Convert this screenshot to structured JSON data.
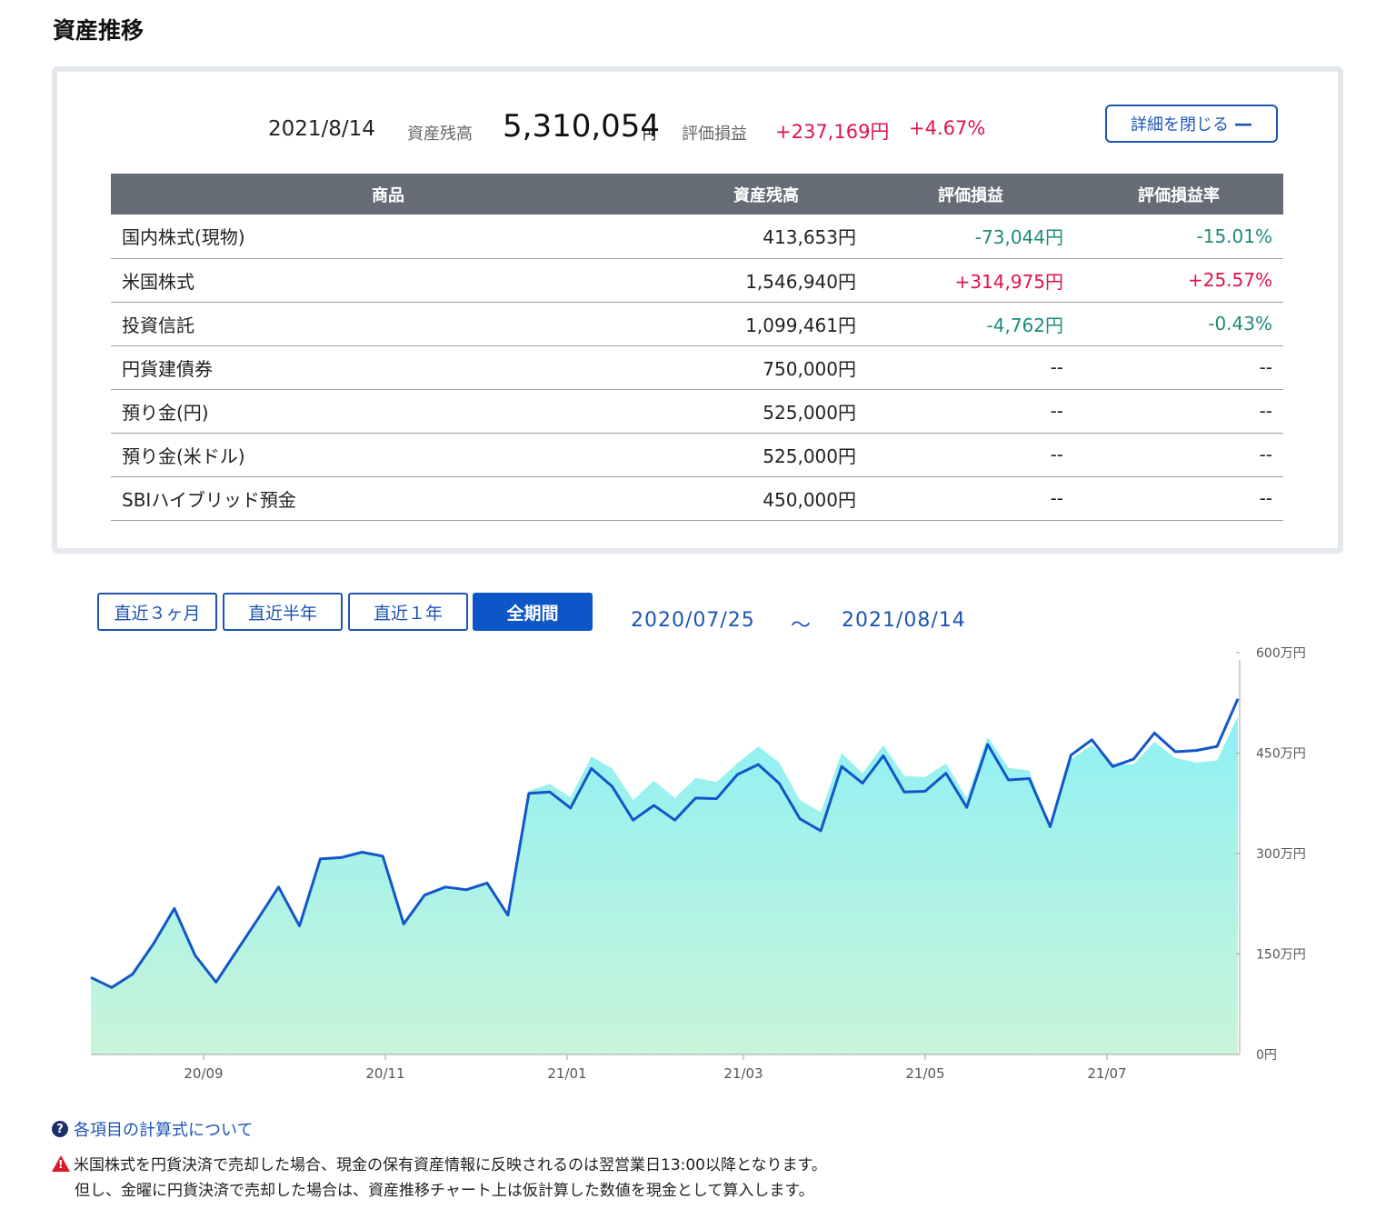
{
  "page": {
    "title": "資産推移"
  },
  "summary": {
    "date": "2021/8/14",
    "balance_label": "資産残高",
    "balance_value": "5,310,054",
    "balance_unit": "円",
    "pl_label": "評価損益",
    "pl_value": "+237,169円",
    "pl_rate": "+4.67%",
    "toggle_label": "詳細を閉じる",
    "toggle_icon": "minus-icon"
  },
  "table": {
    "headers": [
      "商品",
      "資産残高",
      "評価損益",
      "評価損益率"
    ],
    "rows": [
      {
        "name": "国内株式(現物)",
        "balance": "413,653円",
        "pl": "-73,044円",
        "rate": "-15.01%",
        "sign": "neg"
      },
      {
        "name": "米国株式",
        "balance": "1,546,940円",
        "pl": "+314,975円",
        "rate": "+25.57%",
        "sign": "pos"
      },
      {
        "name": "投資信託",
        "balance": "1,099,461円",
        "pl": "-4,762円",
        "rate": "-0.43%",
        "sign": "neg"
      },
      {
        "name": "円貨建債券",
        "balance": "750,000円",
        "pl": "--",
        "rate": "--",
        "sign": "none"
      },
      {
        "name": "預り金(円)",
        "balance": "525,000円",
        "pl": "--",
        "rate": "--",
        "sign": "none"
      },
      {
        "name": "預り金(米ドル)",
        "balance": "525,000円",
        "pl": "--",
        "rate": "--",
        "sign": "none"
      },
      {
        "name": "SBIハイブリッド預金",
        "balance": "450,000円",
        "pl": "--",
        "rate": "--",
        "sign": "none"
      }
    ]
  },
  "periods": {
    "buttons": [
      "直近３ヶ月",
      "直近半年",
      "直近１年",
      "全期間"
    ],
    "active": "全期間",
    "range_start": "2020/07/25",
    "range_sep": "～",
    "range_end": "2021/08/14"
  },
  "chart_data": {
    "type": "area",
    "x_ticks": [
      "20/09",
      "20/11",
      "21/01",
      "21/03",
      "21/05",
      "21/07"
    ],
    "y_ticks": [
      "0円",
      "150万円",
      "300万円",
      "450万円",
      "600万円"
    ],
    "ylim": [
      0,
      600
    ],
    "y_unit": "万円",
    "series": [
      {
        "name": "",
        "values": [
          115,
          100,
          120,
          165,
          218,
          148,
          108,
          155,
          202,
          250,
          192,
          292,
          294,
          302,
          296,
          195,
          238,
          250,
          246,
          256,
          208,
          390,
          392,
          368,
          427,
          400,
          350,
          372,
          350,
          383,
          382,
          418,
          433,
          405,
          352,
          334,
          430,
          405,
          446,
          392,
          393,
          420,
          369,
          463,
          410,
          412,
          340,
          447,
          470,
          430,
          441,
          480,
          452,
          454,
          460,
          531
        ]
      },
      {
        "name": "",
        "values": [
          113,
          98,
          118,
          162,
          215,
          146,
          106,
          152,
          198,
          246,
          190,
          290,
          292,
          300,
          294,
          193,
          236,
          248,
          244,
          254,
          206,
          394,
          404,
          384,
          445,
          427,
          380,
          409,
          383,
          413,
          407,
          435,
          460,
          436,
          380,
          362,
          450,
          420,
          462,
          416,
          414,
          435,
          383,
          474,
          428,
          424,
          335,
          441,
          462,
          434,
          433,
          467,
          443,
          436,
          439,
          505
        ]
      }
    ],
    "colors": {
      "line": "#1257c9",
      "area_top": "#8ff0f4",
      "area_bottom": "#c9f5d8",
      "axis": "#9aa0a8"
    },
    "grid": false
  },
  "notes": {
    "help_link": "各項目の計算式について",
    "help_icon": "question-icon",
    "warn_icon": "warning-icon",
    "warn_line1": "米国株式を円貨決済で売却した場合、現金の保有資産情報に反映されるのは翌営業日13:00以降となります。",
    "warn_line2": "但し、金曜に円貨決済で売却した場合は、資産推移チャート上は仮計算した数値を現金として算入します。"
  }
}
